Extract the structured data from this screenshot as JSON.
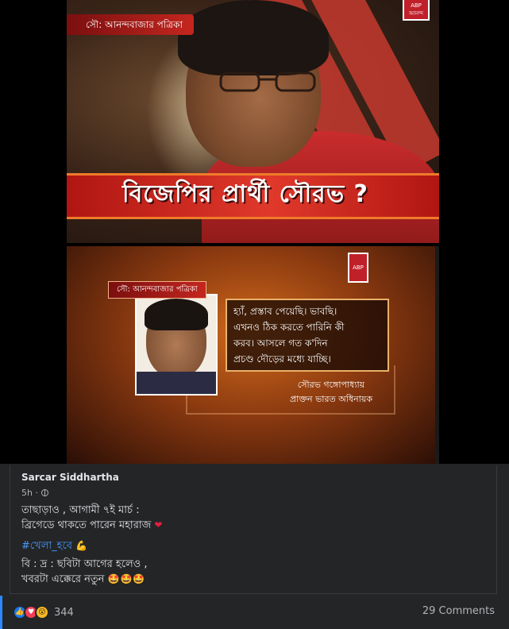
{
  "image_top": {
    "source": "সৌ: আনন্দবাজার পত্রিকা",
    "logo_top": "ABP",
    "logo_bottom": "আনন্দ",
    "headline": "বিজেপির প্রার্থী সৌরভ ?"
  },
  "image_bottom": {
    "source": "সৌ: আনন্দবাজার পত্রিকা",
    "logo_top": "ABP",
    "logo_bottom": "আনন্দ",
    "quote_lines": [
      "হ্যাঁ, প্রস্তাব পেয়েছি। ভাবছি।",
      "এখনও ঠিক করতে পারিনি কী",
      "করব। আসলে গত ক'দিন",
      "প্রচণ্ড দৌড়ের মধ্যে যাচ্ছি।"
    ],
    "byline_name": "সৌরভ গঙ্গোপাধ্যায়",
    "byline_title": "প্রাক্তন ভারত অধিনায়ক"
  },
  "post": {
    "author": "Sarcar Siddhartha",
    "time": "5h ·",
    "line1": "তাছাড়াও , আগামী ৭ই মার্চ  :",
    "line2": "ব্রিগেডে থাকতে পারেন মহারাজ",
    "hashtag": "#খেলা_হবে",
    "line3": "বি : দ্র : ছবিটা আগের হলেও ,",
    "line4": "খবরটা এক্কেরে নতুন",
    "emoji_heart": "❤",
    "emoji_muscle": "💪",
    "emoji_stars": "🤩🤩🤩"
  },
  "footer": {
    "reaction_count": "344",
    "comments": "29 Comments"
  },
  "icons": {
    "like": "like-icon",
    "love": "love-icon",
    "wow": "wow-icon",
    "globe": "globe-icon"
  },
  "colors": {
    "background": "#242526",
    "text": "#e4e6eb",
    "muted": "#b0b3b8",
    "link": "#4599ff",
    "like": "#1877f2",
    "love": "#f33e58",
    "wow": "#f7b928",
    "headline_band": "#e0392b"
  }
}
